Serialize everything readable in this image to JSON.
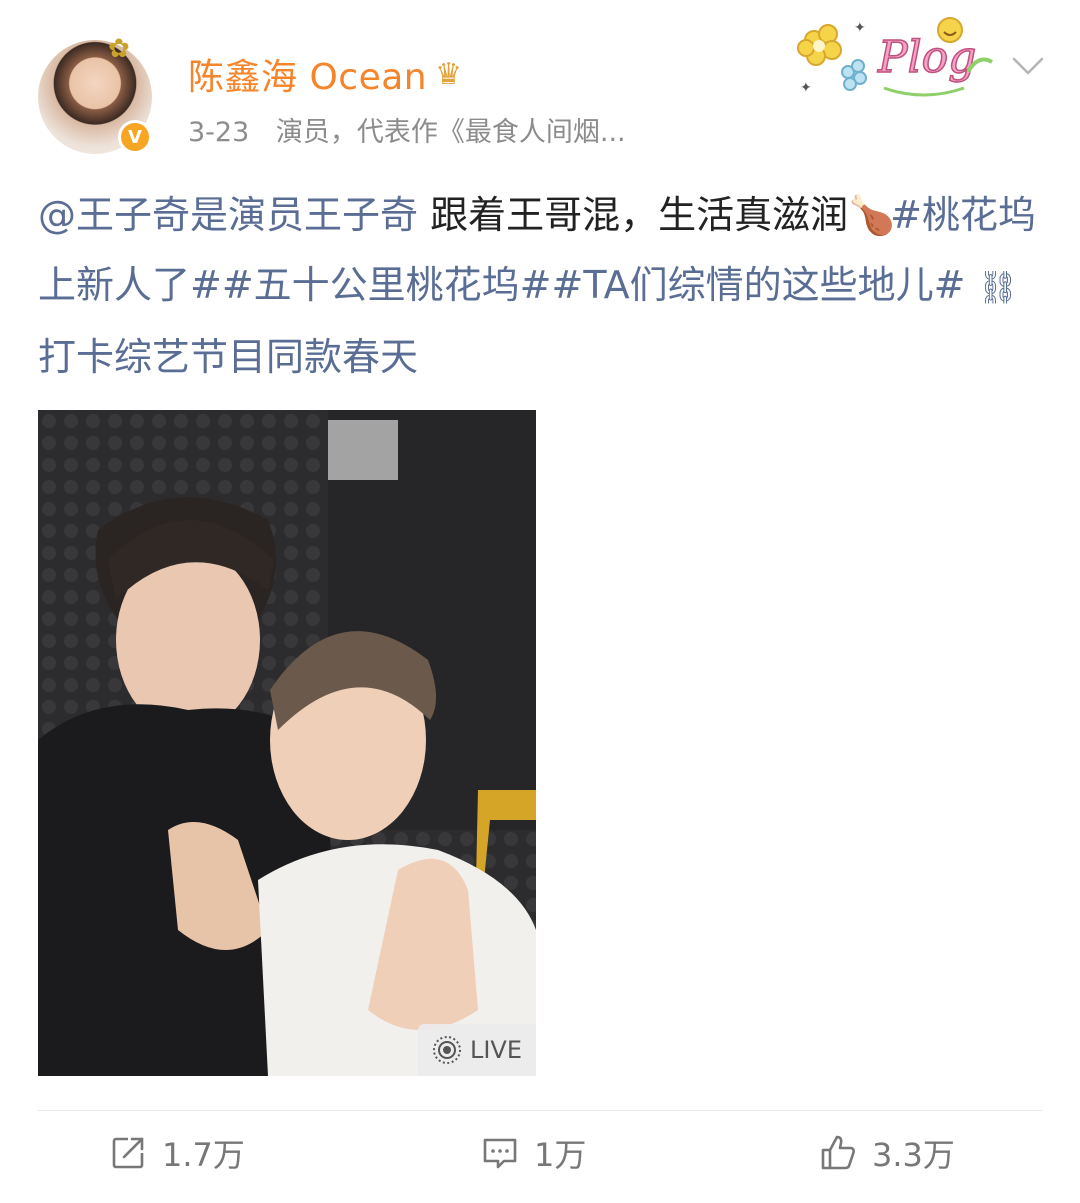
{
  "header": {
    "username": "陈鑫海 Ocean",
    "date": "3-23",
    "description": "演员，代表作《最食人间烟...",
    "sticker_text": "Plog"
  },
  "post": {
    "mention": "@王子奇是演员王子奇",
    "text_1": " 跟着王哥混，生活真滋润",
    "emoji": "🍗",
    "hashtag_1": "#桃花坞上新人了#",
    "hashtag_2": "#五十公里桃花坞#",
    "hashtag_3": "#TA们综情的这些地儿#",
    "link_label": "打卡综艺节目同款春天"
  },
  "photo": {
    "live_label": "LIVE"
  },
  "actions": {
    "share_count": "1.7万",
    "comment_count": "1万",
    "like_count": "3.3万"
  },
  "colors": {
    "username": "#f5842a",
    "link": "#5a6d94",
    "muted": "#8c8c8c"
  }
}
